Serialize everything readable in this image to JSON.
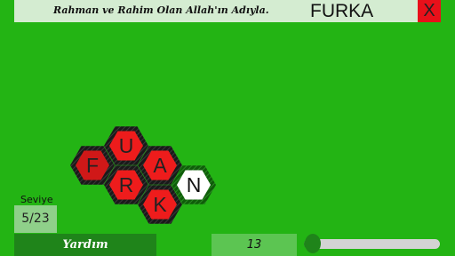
{
  "header": {
    "basmala": "Rahman ve Rahim Olan Allah'ın Adıyla.",
    "word": "FURKA",
    "close_label": "X"
  },
  "board": {
    "tiles": [
      {
        "id": "f",
        "letter": "F",
        "state": "selected",
        "color": "#d01818"
      },
      {
        "id": "u",
        "letter": "U",
        "state": "selected",
        "color": "#ee1c1c"
      },
      {
        "id": "a",
        "letter": "A",
        "state": "selected",
        "color": "#ee1c1c"
      },
      {
        "id": "r",
        "letter": "R",
        "state": "selected",
        "color": "#ee1c1c"
      },
      {
        "id": "k",
        "letter": "K",
        "state": "selected",
        "color": "#ee1c1c"
      },
      {
        "id": "n",
        "letter": "N",
        "state": "unselected",
        "color": "#ffffff"
      }
    ]
  },
  "level": {
    "label": "Seviye",
    "value": "5/23"
  },
  "footer": {
    "help_label": "Yardım",
    "counter": "13",
    "slider_level": 0.03
  },
  "colors": {
    "background": "#23b414",
    "tile_border": "#111111",
    "tile_selected": "#ee1c1c",
    "accent_dark": "#1f841a",
    "close": "#e8101a"
  }
}
